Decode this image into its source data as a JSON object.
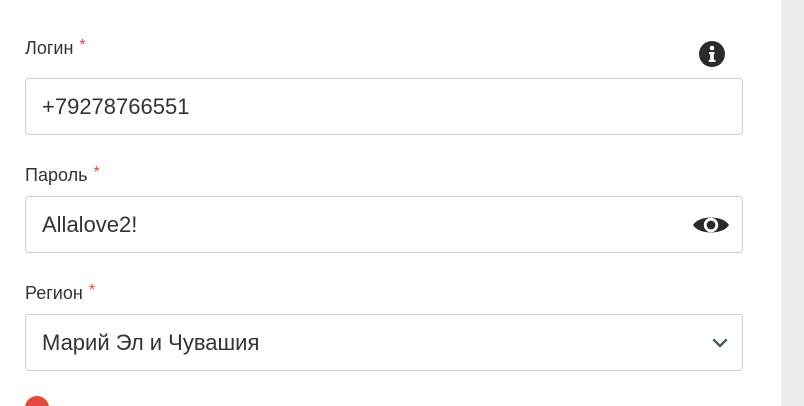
{
  "login": {
    "label": "Логин",
    "required_mark": "*",
    "value": "+79278766551"
  },
  "password": {
    "label": "Пароль",
    "required_mark": "*",
    "value": "Allalove2!"
  },
  "region": {
    "label": "Регион",
    "required_mark": "*",
    "selected": "Марий Эл и Чувашия"
  },
  "icons": {
    "info": "info-circle-icon",
    "show_password": "eye-icon",
    "dropdown": "chevron-down-icon",
    "error": "alert-circle-icon"
  },
  "colors": {
    "required": "#e2483d",
    "error": "#e2483d",
    "border": "#cfcfcf",
    "text": "#333333"
  }
}
